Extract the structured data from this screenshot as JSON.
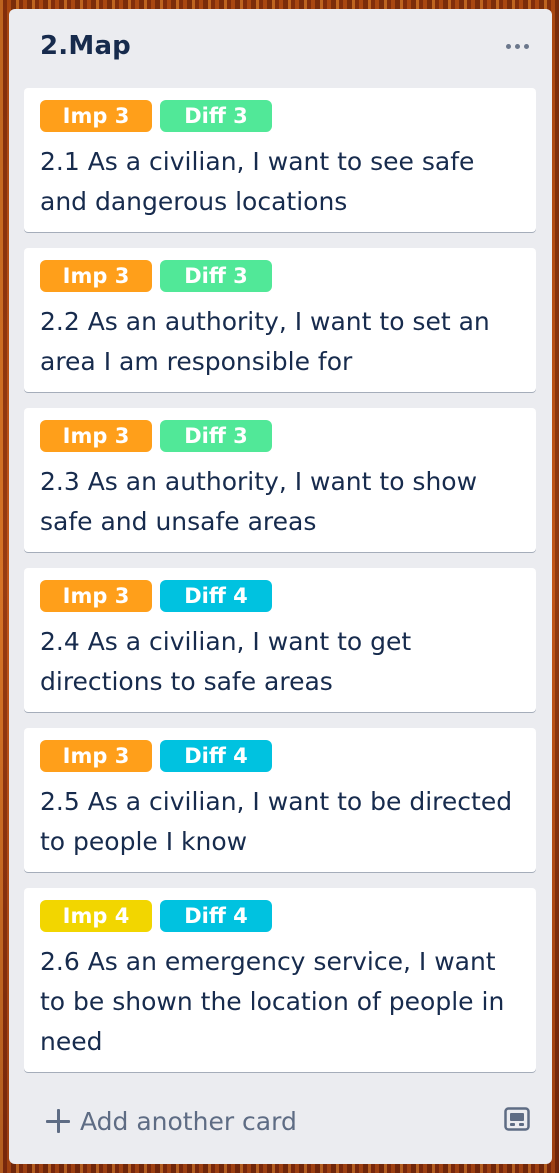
{
  "list": {
    "title": "2.Map",
    "add_card_label": "Add another card"
  },
  "colors": {
    "imp_orange": "#ff9f1a",
    "imp_yellow": "#f2d600",
    "diff_green": "#51e898",
    "diff_sky": "#00c2e0"
  },
  "cards": [
    {
      "imp": {
        "text": "Imp 3",
        "color": "#ff9f1a"
      },
      "diff": {
        "text": "Diff 3",
        "color": "#51e898"
      },
      "title": "2.1 As a civilian, I want to see safe and dangerous locations"
    },
    {
      "imp": {
        "text": "Imp 3",
        "color": "#ff9f1a"
      },
      "diff": {
        "text": "Diff 3",
        "color": "#51e898"
      },
      "title": "2.2 As an authority, I want to set an area I am responsible for"
    },
    {
      "imp": {
        "text": "Imp 3",
        "color": "#ff9f1a"
      },
      "diff": {
        "text": "Diff 3",
        "color": "#51e898"
      },
      "title": "2.3 As an authority, I want to show safe and unsafe areas"
    },
    {
      "imp": {
        "text": "Imp 3",
        "color": "#ff9f1a"
      },
      "diff": {
        "text": "Diff 4",
        "color": "#00c2e0"
      },
      "title": "2.4 As a civilian, I want to get directions to safe areas"
    },
    {
      "imp": {
        "text": "Imp 3",
        "color": "#ff9f1a"
      },
      "diff": {
        "text": "Diff 4",
        "color": "#00c2e0"
      },
      "title": "2.5 As a civilian, I want to be directed to people I know"
    },
    {
      "imp": {
        "text": "Imp 4",
        "color": "#f2d600"
      },
      "diff": {
        "text": "Diff 4",
        "color": "#00c2e0"
      },
      "title": "2.6 As an emergency service, I want to be shown the location of people in need"
    }
  ]
}
